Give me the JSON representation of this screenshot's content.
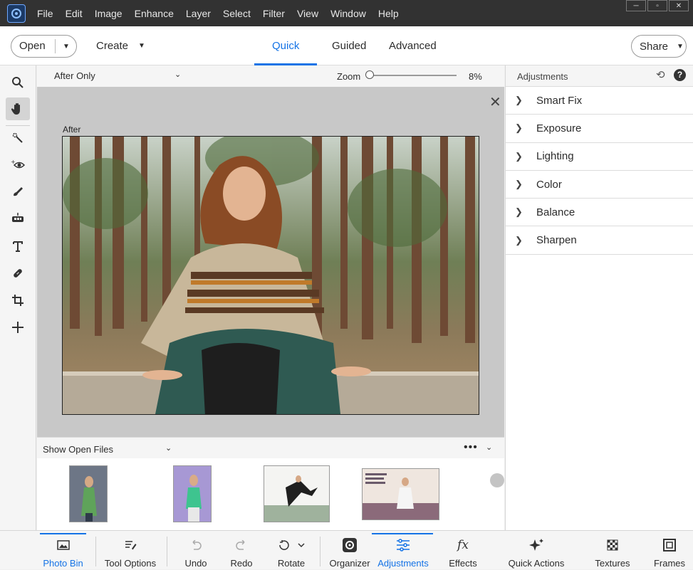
{
  "menubar": {
    "items": [
      "File",
      "Edit",
      "Image",
      "Enhance",
      "Layer",
      "Select",
      "Filter",
      "View",
      "Window",
      "Help"
    ]
  },
  "toolbar": {
    "open_label": "Open",
    "create_label": "Create",
    "share_label": "Share",
    "modes": [
      {
        "label": "Quick",
        "active": true
      },
      {
        "label": "Guided",
        "active": false
      },
      {
        "label": "Advanced",
        "active": false
      }
    ]
  },
  "tools": [
    "zoom-tool",
    "hand-tool",
    "quick-selection-tool",
    "red-eye-tool",
    "whiten-teeth-tool",
    "straighten-tool",
    "type-tool",
    "spot-healing-tool",
    "crop-tool",
    "move-tool"
  ],
  "view": {
    "mode": "After Only",
    "zoom_label": "Zoom",
    "zoom_value": "8%",
    "zoom_fraction": 0.08,
    "after_label": "After"
  },
  "bin": {
    "filter_label": "Show Open Files",
    "more_label": "•••"
  },
  "adjustments": {
    "title": "Adjustments",
    "items": [
      "Smart Fix",
      "Exposure",
      "Lighting",
      "Color",
      "Balance",
      "Sharpen"
    ]
  },
  "taskbar": {
    "items": [
      "Photo Bin",
      "Tool Options",
      "Undo",
      "Redo",
      "Rotate",
      "Organizer",
      "Adjustments",
      "Effects",
      "Quick Actions",
      "Textures",
      "Frames"
    ],
    "active": "Adjustments"
  },
  "colors": {
    "accent": "#1473e6",
    "menubar": "#323232"
  }
}
